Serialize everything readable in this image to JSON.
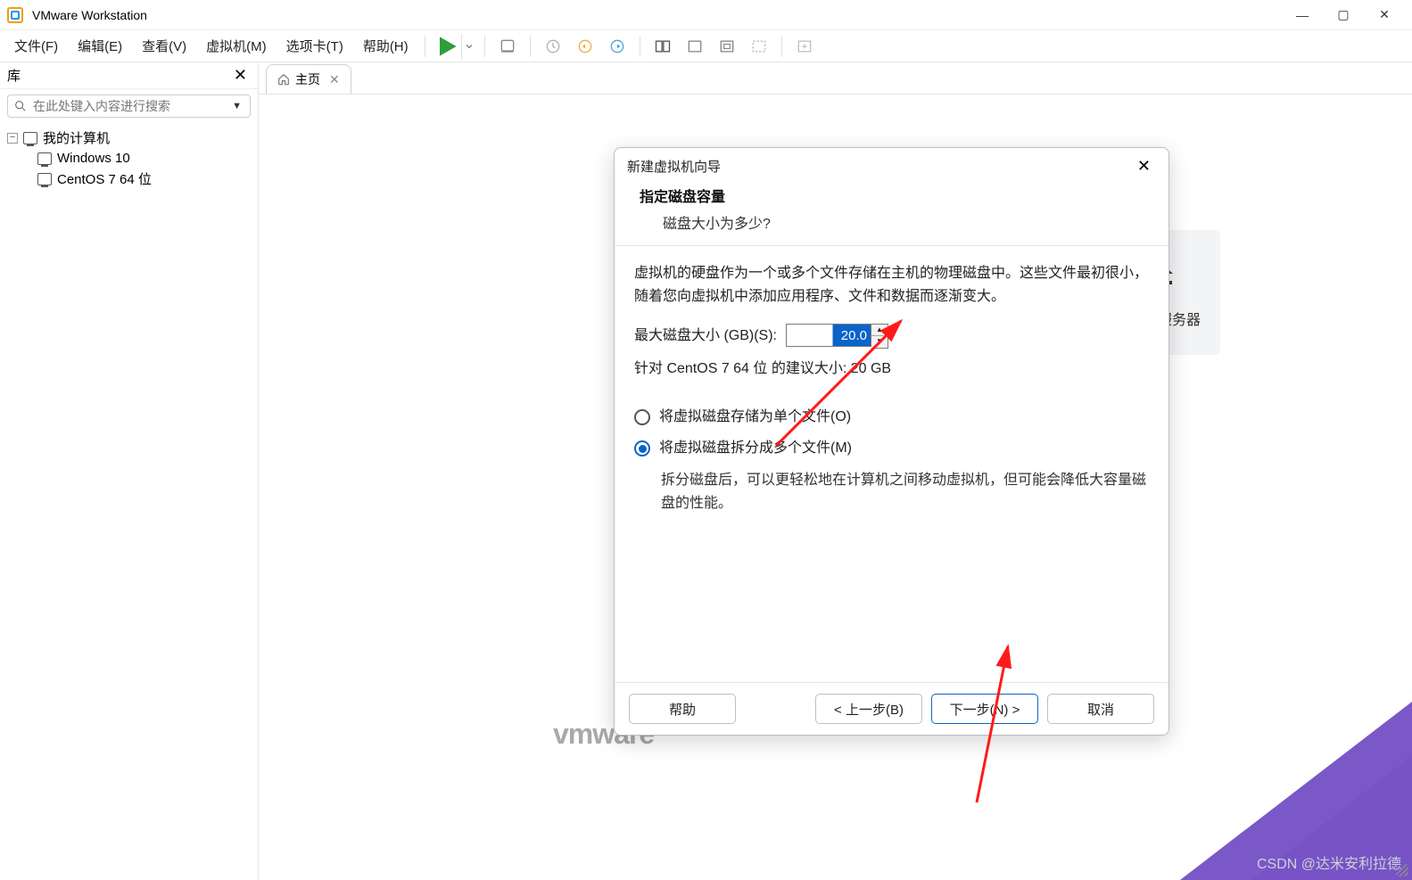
{
  "titlebar": {
    "title": "VMware Workstation"
  },
  "menu": {
    "file": "文件(F)",
    "edit": "编辑(E)",
    "view": "查看(V)",
    "vm": "虚拟机(M)",
    "tabs": "选项卡(T)",
    "help": "帮助(H)"
  },
  "sidebar": {
    "title": "库",
    "search_placeholder": "在此处键入内容进行搜索",
    "root": "我的计算机",
    "items": [
      "Windows 10",
      "CentOS 7 64 位"
    ]
  },
  "tab": {
    "home": "主页"
  },
  "remote_tile": {
    "label": "接远程服务器"
  },
  "watermark": "vmware",
  "csdn": "CSDN @达米安利拉德",
  "dialog": {
    "title": "新建虚拟机向导",
    "h1": "指定磁盘容量",
    "h2": "磁盘大小为多少?",
    "desc": "虚拟机的硬盘作为一个或多个文件存储在主机的物理磁盘中。这些文件最初很小，随着您向虚拟机中添加应用程序、文件和数据而逐渐变大。",
    "max_label": "最大磁盘大小 (GB)(S):",
    "size_value": "20.0",
    "reco_prefix": "针对 ",
    "reco_os": "CentOS 7 64 位",
    "reco_suffix": " 的建议大小: 20 GB",
    "radio_single": "将虚拟磁盘存储为单个文件(O)",
    "radio_split": "将虚拟磁盘拆分成多个文件(M)",
    "split_note": "拆分磁盘后，可以更轻松地在计算机之间移动虚拟机，但可能会降低大容量磁盘的性能。",
    "help": "帮助",
    "back": "< 上一步(B)",
    "next": "下一步(N) >",
    "cancel": "取消"
  }
}
